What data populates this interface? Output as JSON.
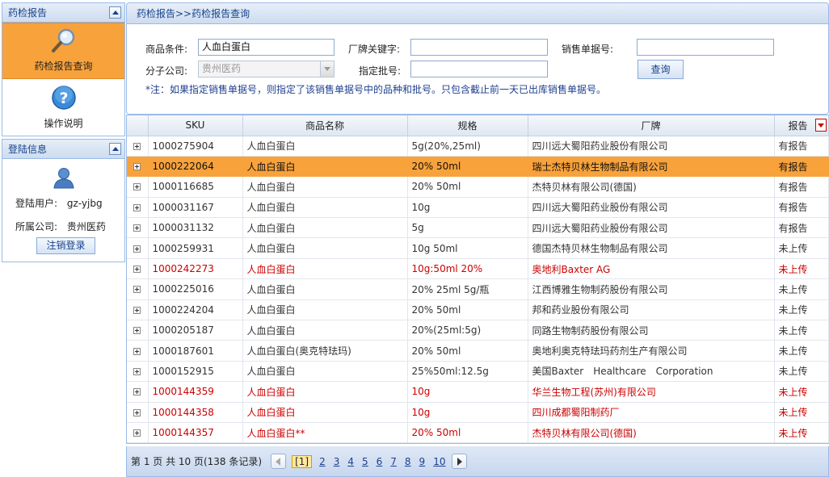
{
  "sidebar": {
    "report_panel": {
      "title": "药检报告",
      "items": [
        {
          "label": "药检报告查询",
          "icon": "magnifier-icon",
          "active": true
        },
        {
          "label": "操作说明",
          "icon": "help-icon",
          "active": false
        }
      ]
    },
    "login_panel": {
      "title": "登陆信息",
      "user_label": "登陆用户:",
      "user_value": "gz-yjbg",
      "company_label": "所属公司:",
      "company_value": "贵州医药",
      "logout_label": "注销登录"
    }
  },
  "main": {
    "breadcrumb": "药检报告>>药检报告查询",
    "search": {
      "product_label": "商品条件:",
      "product_value": "人血白蛋白",
      "brand_label": "厂牌关键字:",
      "brand_value": "",
      "sales_no_label": "销售单据号:",
      "sales_no_value": "",
      "branch_label": "分子公司:",
      "branch_value": "贵州医药",
      "batch_label": "指定批号:",
      "batch_value": "",
      "query_label": "查询",
      "note": "*注：如果指定销售单据号，则指定了该销售单据号中的品种和批号。只包含截止前一天已出库销售单据号。"
    },
    "grid": {
      "columns": [
        "SKU",
        "商品名称",
        "规格",
        "厂牌",
        "报告"
      ],
      "rows": [
        {
          "sku": "1000275904",
          "name": "人血白蛋白",
          "spec": "5g(20%,25ml)",
          "brand": "四川远大蜀阳药业股份有限公司",
          "report": "有报告",
          "state": "normal"
        },
        {
          "sku": "1000222064",
          "name": "人血白蛋白",
          "spec": "20% 50ml",
          "brand": "瑞士杰特贝林生物制品有限公司",
          "report": "有报告",
          "state": "selected"
        },
        {
          "sku": "1000116685",
          "name": "人血白蛋白",
          "spec": "20% 50ml",
          "brand": "杰特贝林有限公司(德国)",
          "report": "有报告",
          "state": "normal"
        },
        {
          "sku": "1000031167",
          "name": "人血白蛋白",
          "spec": "10g",
          "brand": "四川远大蜀阳药业股份有限公司",
          "report": "有报告",
          "state": "normal"
        },
        {
          "sku": "1000031132",
          "name": "人血白蛋白",
          "spec": "5g",
          "brand": "四川远大蜀阳药业股份有限公司",
          "report": "有报告",
          "state": "normal"
        },
        {
          "sku": "1000259931",
          "name": "人血白蛋白",
          "spec": "10g 50ml",
          "brand": "德国杰特贝林生物制品有限公司",
          "report": "未上传",
          "state": "normal"
        },
        {
          "sku": "1000242273",
          "name": "人血白蛋白",
          "spec": "10g:50ml 20%",
          "brand": "奥地利Baxter AG",
          "report": "未上传",
          "state": "red"
        },
        {
          "sku": "1000225016",
          "name": "人血白蛋白",
          "spec": "20% 25ml 5g/瓶",
          "brand": "江西博雅生物制药股份有限公司",
          "report": "未上传",
          "state": "normal"
        },
        {
          "sku": "1000224204",
          "name": "人血白蛋白",
          "spec": "20% 50ml",
          "brand": "邦和药业股份有限公司",
          "report": "未上传",
          "state": "normal"
        },
        {
          "sku": "1000205187",
          "name": "人血白蛋白",
          "spec": "20%(25ml:5g)",
          "brand": "同路生物制药股份有限公司",
          "report": "未上传",
          "state": "normal"
        },
        {
          "sku": "1000187601",
          "name": "人血白蛋白(奥克特珐玛)",
          "spec": "20% 50ml",
          "brand": "奥地利奥克特珐玛药剂生产有限公司",
          "report": "未上传",
          "state": "normal"
        },
        {
          "sku": "1000152915",
          "name": "人血白蛋白",
          "spec": "25%50ml:12.5g",
          "brand": "美国Baxter　Healthcare　Corporation",
          "report": "未上传",
          "state": "normal"
        },
        {
          "sku": "1000144359",
          "name": "人血白蛋白",
          "spec": "10g",
          "brand": "华兰生物工程(苏州)有限公司",
          "report": "未上传",
          "state": "red"
        },
        {
          "sku": "1000144358",
          "name": "人血白蛋白",
          "spec": "10g",
          "brand": "四川成都蜀阳制药厂",
          "report": "未上传",
          "state": "red"
        },
        {
          "sku": "1000144357",
          "name": "人血白蛋白**",
          "spec": "20% 50ml",
          "brand": "杰特贝林有限公司(德国)",
          "report": "未上传",
          "state": "red"
        }
      ]
    },
    "pager": {
      "info": "第 1 页 共 10 页(138 条记录)",
      "current": "[1]",
      "pages": [
        "2",
        "3",
        "4",
        "5",
        "6",
        "7",
        "8",
        "9",
        "10"
      ]
    }
  },
  "colors": {
    "accent": "#f8a23c",
    "header_text": "#15428b",
    "red_row": "#cc0000",
    "border": "#99bbe8"
  }
}
